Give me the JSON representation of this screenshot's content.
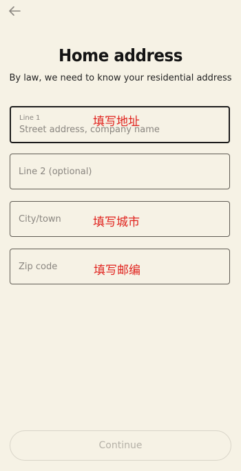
{
  "header": {
    "back_icon": "arrow-left-icon",
    "title": "Home address",
    "subtitle": "By law, we need to know your residential address"
  },
  "form": {
    "line1": {
      "label": "Line 1",
      "placeholder": "Street address, company name",
      "annotation": "填写地址"
    },
    "line2": {
      "placeholder": "Line 2 (optional)"
    },
    "city": {
      "placeholder": "City/town",
      "annotation": "填写城市"
    },
    "zip": {
      "placeholder": "Zip code",
      "annotation": "填写邮编"
    }
  },
  "footer": {
    "continue_label": "Continue"
  },
  "colors": {
    "background": "#f6f2e5",
    "annotation": "#e0221d",
    "disabled_text": "#b5b1a7"
  }
}
